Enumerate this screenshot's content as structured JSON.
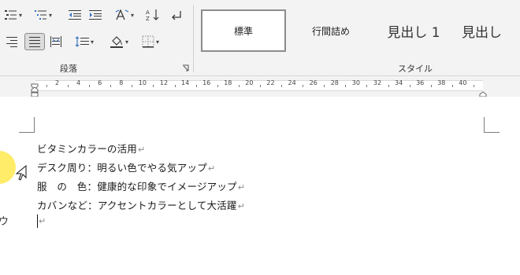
{
  "ribbon": {
    "paragraph_group_label": "段落",
    "styles_group_label": "スタイル",
    "styles": [
      "標準",
      "行間詰め",
      "見出し 1",
      "見出し"
    ]
  },
  "ruler": {
    "numbers": [
      "2",
      "4",
      "6",
      "8",
      "10",
      "12",
      "14",
      "16",
      "18",
      "20",
      "22",
      "24",
      "26",
      "28",
      "30",
      "32",
      "34",
      "36",
      "38",
      "40"
    ]
  },
  "document": {
    "lines": [
      "ビタミンカラーの活用",
      "デスク周り：明るい色でやる気アップ",
      "服　の　色：健康的な印象でイメージアップ",
      "カバンなど：アクセントカラーとして大活躍"
    ],
    "paragraph_mark": "↵",
    "side_char": "ウ"
  },
  "colors": {
    "ribbon_bg": "#f3f3f3",
    "cursor_highlight": "#ffe94d"
  }
}
